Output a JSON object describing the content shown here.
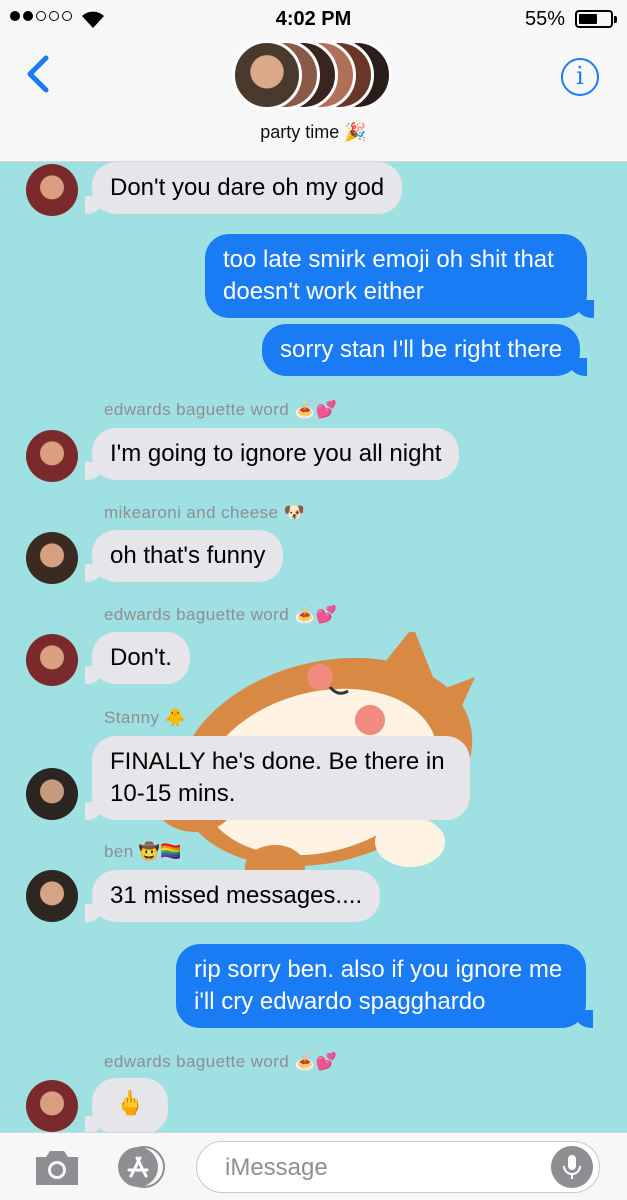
{
  "status_bar": {
    "time": "4:02 PM",
    "battery": "55%",
    "battery_level": 0.55
  },
  "header": {
    "group_name": "party time 🎉",
    "info_glyph": "i"
  },
  "messages": [
    {
      "type": "in",
      "text": "Don't you dare oh my god"
    },
    {
      "type": "out",
      "text": "too late smirk emoji oh shit that doesn't work either"
    },
    {
      "type": "out",
      "text": "sorry stan I'll be right there"
    },
    {
      "type": "in",
      "sender": "edwards baguette word 🍝💕",
      "text": "I'm going to ignore you all night"
    },
    {
      "type": "in",
      "sender": "mikearoni and cheese 🐶",
      "text": "oh that's funny"
    },
    {
      "type": "in",
      "sender": "edwards baguette word 🍝💕",
      "text": "Don't."
    },
    {
      "type": "in",
      "sender": "Stanny 🐥",
      "text": "FINALLY he's done. Be there in 10-15 mins."
    },
    {
      "type": "in",
      "sender": "ben 🤠🏳️‍🌈",
      "text": "31 missed messages...."
    },
    {
      "type": "out",
      "text": "rip sorry ben. also if you ignore me i'll cry edwardo spagghardo"
    },
    {
      "type": "in",
      "sender": "edwards baguette word 🍝💕",
      "text": "🖕"
    }
  ],
  "composer": {
    "placeholder": "iMessage"
  },
  "icons": {
    "back": "chevron-left-icon",
    "info": "info-icon",
    "camera": "camera-icon",
    "apps": "app-store-icon",
    "mic": "microphone-icon"
  },
  "colors": {
    "accent": "#1a7cf5",
    "background": "#9fe0e3",
    "incoming": "#e5e5ea"
  }
}
